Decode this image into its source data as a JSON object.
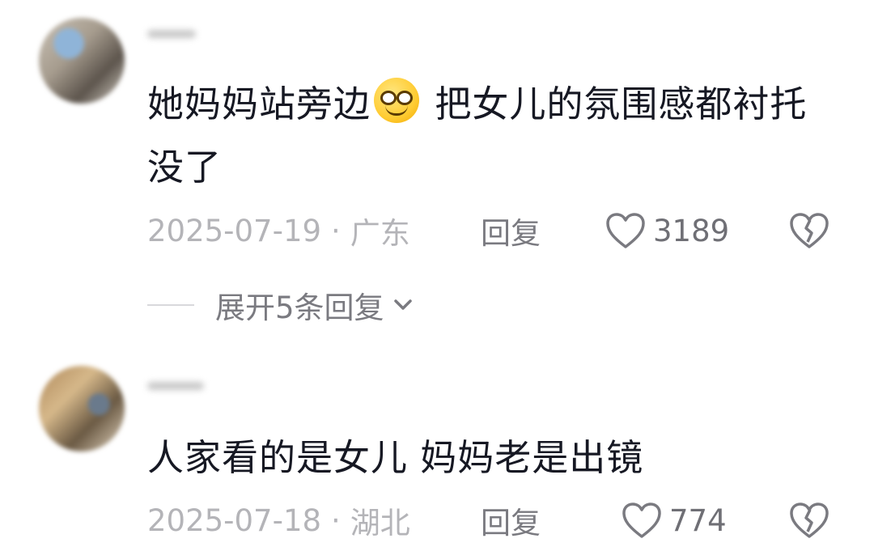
{
  "comments": [
    {
      "content_before_emoji": "她妈妈站旁边",
      "content_after_emoji": " 把女儿的氛围感都衬托没了",
      "date": "2025-07-19",
      "location": "广东",
      "reply_label": "回复",
      "likes": "3189"
    },
    {
      "content": "人家看的是女儿 妈妈老是出镜",
      "date": "2025-07-18",
      "location": "湖北",
      "reply_label": "回复",
      "likes": "774"
    }
  ],
  "expand_replies": {
    "label": "展开5条回复"
  },
  "meta_separator": "·",
  "colors": {
    "text": "#161823",
    "meta": "#b4b4b8",
    "action": "#7a7a80"
  },
  "icons": [
    "heart-icon",
    "broken-heart-icon",
    "chevron-down-icon",
    "grin-emoji-icon"
  ]
}
